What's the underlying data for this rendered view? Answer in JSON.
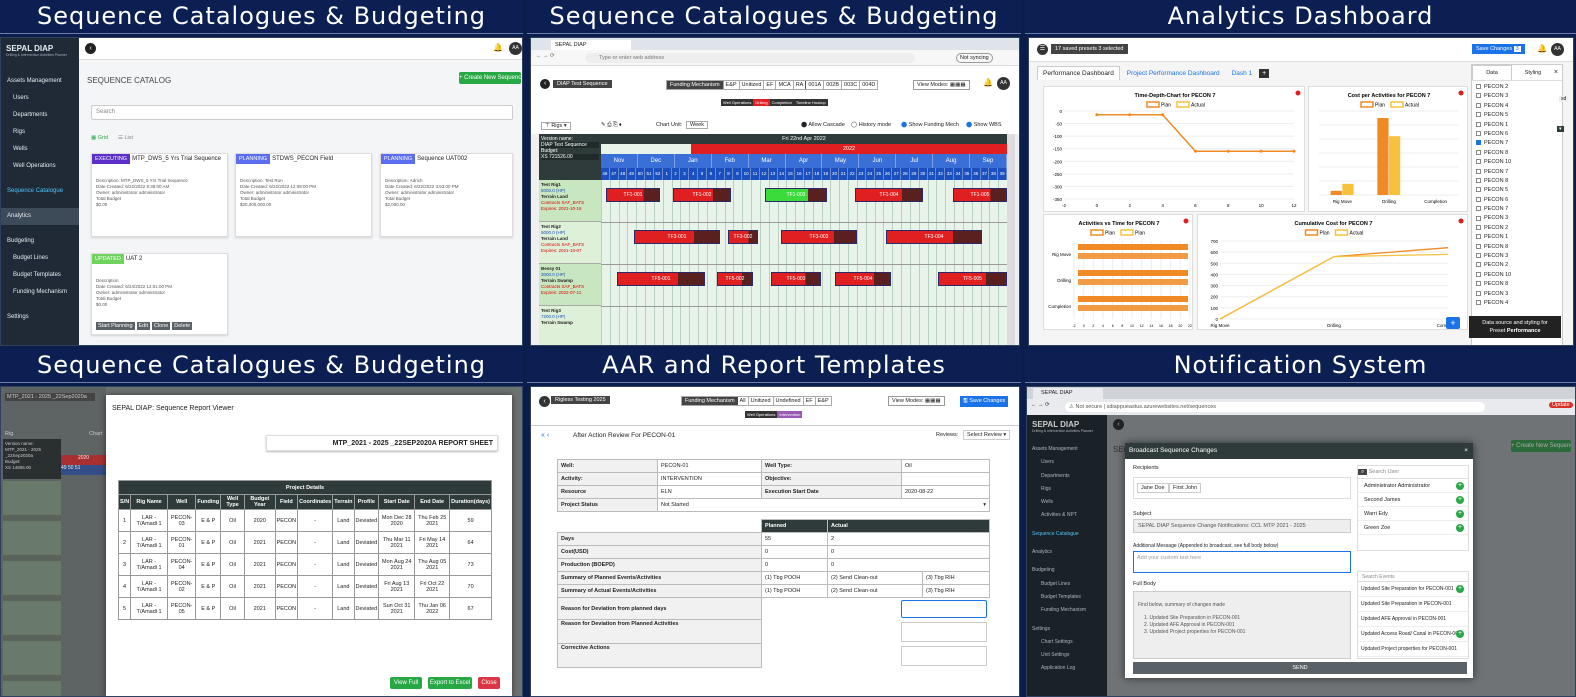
{
  "titles": [
    "Sequence Catalogues & Budgeting",
    "Sequence Catalogues & Budgeting",
    "Analytics Dashboard",
    "Sequence Catalogues & Budgeting",
    "AAR and Report Templates",
    "Notification System"
  ],
  "p1": {
    "brand": "SEPAL DIAP",
    "brand_sub": "Drilling & Intervention Activities Planner",
    "nav": [
      "Assets Management",
      "Users",
      "Departments",
      "Rigs",
      "Wells",
      "Well Operations",
      "Sequence Catalogue",
      "Analytics",
      "Budgeting",
      "Budget Lines",
      "Budget Templates",
      "Funding Mechanism",
      "Settings"
    ],
    "page_title": "SEQUENCE CATALOG",
    "create_btn": "+ Create New Sequence",
    "search_placeholder": "Search",
    "view_grid": "Grid",
    "view_list": "List",
    "avatar": "AA",
    "cards": [
      {
        "status": "EXECUTING",
        "title": "MTP_DWS_5 Yrs Trial Sequence",
        "color": "#5b2fc8",
        "lines": [
          "Description: MTP_DWS_5 Yrs Trial Sequence",
          "Date Created: 6/22/2022 8:38:00 AM",
          "Owner: administrator administrator",
          "Total Budget",
          "$0.00"
        ]
      },
      {
        "status": "PLANNING",
        "title": "STDWS_PECON Field",
        "color": "#5b6ef0",
        "lines": [
          "Description: Test Run",
          "Date Created: 6/22/2022 12:08:00 PM",
          "Owner: administrator administrator",
          "Total Budget",
          "$20,000,000.00"
        ]
      },
      {
        "status": "PLANNING",
        "title": "Sequence UAT002",
        "color": "#5b6ef0",
        "lines": [
          "Description: Adrich",
          "Date Created: 6/22/2022 3:53:00 PM",
          "Owner: administrator administrator",
          "Total Budget",
          "$2,000.00"
        ]
      },
      {
        "status": "UPDATED",
        "title": "UAT 2",
        "color": "#6fd35d",
        "lines": [
          "Description",
          "Date Created: 6/24/2022 12:01:00 PM",
          "Owner: administrator administrator",
          "Total Budget",
          "$0.00"
        ]
      }
    ],
    "card_actions": [
      "Start Planning",
      "Edit",
      "Clone",
      "Delete"
    ]
  },
  "p2": {
    "tab": "SEPAL DIAP",
    "address": "Type or enter web address",
    "sync": "Not syncing",
    "sequence": "DIAP Test Sequence",
    "funding_label": "Funding Mechanism",
    "funding": [
      "E&P",
      "Unitized",
      "EF",
      "MCA",
      "RA",
      "001A",
      "002B",
      "003C",
      "004D"
    ],
    "legend": [
      "Well Operations",
      "Drilling",
      "Completion",
      "Timeline Hookup"
    ],
    "view_modes": "View Modes:",
    "filter": "Rigs",
    "chart_unit_label": "Chart Unit:",
    "chart_unit": "Week",
    "toggles": [
      "Allow Cascade",
      "History mode",
      "Show Funding Mech",
      "Show WBS"
    ],
    "version_name": "Version name:",
    "version_val": "DIAP Test Sequence",
    "budget_label": "Budget:",
    "budget_val": "XS 721526.00",
    "date_header": "Fri 22nd Apr 2022",
    "year": "2022",
    "months": [
      "Nov",
      "Dec",
      "Jan",
      "Feb",
      "Mar",
      "Apr",
      "May",
      "Jun",
      "Jul",
      "Aug",
      "Sep"
    ],
    "weeks": [
      "46",
      "47",
      "48",
      "49",
      "50",
      "51",
      "52",
      "1",
      "2",
      "3",
      "4",
      "5",
      "6",
      "7",
      "8",
      "9",
      "10",
      "11",
      "12",
      "13",
      "14",
      "15",
      "16",
      "17",
      "18",
      "19",
      "20",
      "21",
      "22",
      "23",
      "24",
      "25",
      "26",
      "27",
      "28",
      "29",
      "30",
      "31",
      "32",
      "33",
      "34",
      "35",
      "36",
      "37",
      "38",
      "39"
    ],
    "rigs": [
      {
        "name": "Test Rig1",
        "line2": "5000.0 (HP)",
        "line3": "Terrain Land",
        "red1": "Contracts SAF_BATS",
        "red2": "Expires: 2021-10-16"
      },
      {
        "name": "Test Rig2",
        "line2": "5000.0 (HP)",
        "line3": "Terrain Land",
        "red1": "Contracts SAF_BATS",
        "red2": "Expires: 2021-10-07"
      },
      {
        "name": "Bessy 01",
        "line2": "3000.0 (HP)",
        "line3": "Terrain Swamp",
        "red1": "Contracts SAF_BATS",
        "red2": "Expires: 2022-07-11"
      },
      {
        "name": "Test Rig3",
        "line2": "7200.0 (HP)",
        "line3": "Terrain Swamp",
        "red1": "",
        "red2": ""
      }
    ],
    "bars": [
      "TF1-001",
      "TF1-002",
      "TF1-003",
      "TF1-004",
      "TF1-005",
      "TF3-001",
      "TF3-002",
      "TF3-003",
      "TF3-004",
      "TF5-001",
      "TF5-002",
      "TF5-003",
      "TF5-004",
      "TF5-005"
    ]
  },
  "p3": {
    "presets": "17 saved presets 3 selected",
    "save_btn": "Save Changes",
    "save_count": "3",
    "avatar": "AA",
    "tabs": [
      "Performance Dashboard",
      "Project Performance Dashboard",
      "Dash 1"
    ],
    "side_tabs": [
      "Data",
      "Styling"
    ],
    "list": [
      "PECON 2",
      "PECON 3",
      "PECON 4",
      "PECON 5",
      "PECON 1",
      "PECON 6",
      "PECON 7",
      "PECON 8",
      "PECON 10",
      "PECON 7",
      "PECON 8",
      "PECON 5",
      "PECON 6",
      "PECON 7",
      "PECON 3",
      "PECON 2",
      "PECON 1",
      "PECON 8",
      "PECON 3",
      "PECON 2",
      "PECON 10",
      "PECON 8",
      "PECON 3",
      "PECON 4"
    ],
    "checked_index": 6,
    "tooltip_line1": "Data source and styling for",
    "tooltip_line2": "Preset",
    "tooltip_bold": "Performance",
    "dropdown_frag": "sd",
    "legend_plan": "Plan",
    "legend_actual": "Actual",
    "colors": {
      "plan": "#f08a24",
      "actual": "#f6c23e",
      "primary": "#1a73e8",
      "red": "#e02020"
    }
  },
  "chart_data": [
    {
      "type": "line",
      "title": "Time-Depth-Chart for PECON 7",
      "legend": [
        "Plan",
        "Actual"
      ],
      "xlabel": "",
      "ylabel": "",
      "x": [
        0,
        2,
        4,
        6,
        8,
        10,
        12
      ],
      "series": [
        {
          "name": "Plan",
          "values": [
            -15,
            -15,
            -15,
            -160,
            -160,
            -160,
            -160
          ]
        }
      ],
      "yticks": [
        "0",
        "-50",
        "-100",
        "-150",
        "-200",
        "-250",
        "-300",
        "-350"
      ],
      "xticks": [
        "-2",
        "0",
        "2",
        "4",
        "6",
        "8",
        "10",
        "12"
      ],
      "ylim": [
        -350,
        0
      ]
    },
    {
      "type": "bar",
      "title": "Cost per Activities for PECON 7",
      "legend": [
        "Plan",
        "Actual"
      ],
      "categories": [
        "Rig Move",
        "Drilling",
        "Completion"
      ],
      "series": [
        {
          "name": "Plan",
          "values": [
            3,
            55,
            0
          ]
        },
        {
          "name": "Actual",
          "values": [
            8,
            42,
            0
          ]
        }
      ]
    },
    {
      "type": "bar",
      "title": "Activities vs Time for PECON 7",
      "legend": [
        "Plan",
        "Plan"
      ],
      "categories": [
        "Rig Move",
        "Drilling",
        "Completion"
      ],
      "orientation": "horizontal",
      "xticks": [
        "-2",
        "0",
        "2",
        "4",
        "6",
        "8",
        "10",
        "12",
        "14",
        "16",
        "18",
        "20",
        "22"
      ]
    },
    {
      "type": "line",
      "title": "Cumulative Cost for PECON 7",
      "legend": [
        "Plan",
        "Actual"
      ],
      "categories": [
        "Rig Move",
        "Drilling",
        "Completion"
      ],
      "series": [
        {
          "name": "Plan",
          "values": [
            0,
            560,
            640
          ]
        },
        {
          "name": "Actual",
          "values": [
            0,
            560,
            580
          ]
        }
      ],
      "yticks": [
        "700",
        "600",
        "500",
        "400",
        "300",
        "200",
        "100",
        "0"
      ],
      "ylim": [
        0,
        700
      ]
    }
  ],
  "p4": {
    "modal_title": "SEPAL DIAP: Sequence Report Viewer",
    "sheet_title": "MTP_2021 - 2025 _22SEP2020A REPORT SHEET",
    "table_title": "Project Details",
    "headers": [
      "S/N",
      "Rig Name",
      "Well",
      "Funding",
      "Well Type",
      "Budget Year",
      "Field",
      "Coordinates",
      "Terrain",
      "Profile",
      "Start Date",
      "End Date",
      "Duration(days)"
    ],
    "rows": [
      [
        "1",
        "LAR - T/Amadi 1",
        "PECON-03",
        "E & P",
        "Oil",
        "2020",
        "PECON",
        "-",
        "Land",
        "Deviated",
        "Mon Dec 28 2020",
        "Thu Feb 25 2021",
        "59"
      ],
      [
        "2",
        "LAR - T/Amadi 1",
        "PECON-01",
        "E & P",
        "Oil",
        "2021",
        "PECON",
        "-",
        "Land",
        "Deviated",
        "Thu Mar 11 2021",
        "Fri May 14 2021",
        "64"
      ],
      [
        "3",
        "LAR - T/Amadi 1",
        "PECON-04",
        "E & P",
        "Oil",
        "2021",
        "PECON",
        "-",
        "Land",
        "Deviated",
        "Mon Aug 24 2021",
        "Thu Aug 05 2021",
        "73"
      ],
      [
        "4",
        "LAR - T/Amadi 1",
        "PECON-02",
        "E & P",
        "Oil",
        "2021",
        "PECON",
        "-",
        "Land",
        "Deviated",
        "Fri Aug 13 2021",
        "Fri Oct 22 2021",
        "70"
      ],
      [
        "5",
        "LAR - T/Amadi 1",
        "PECON-05",
        "E & P",
        "Oil",
        "2021",
        "PECON",
        "-",
        "Land",
        "Deviated",
        "Sun Oct 31 2021",
        "Thu Jan 06 2022",
        "67"
      ]
    ],
    "btn_view": "View Full",
    "btn_export": "Export to Excel",
    "btn_close": "Close",
    "bg_seq": "MTP_2021 - 2025 _22Sep2020a",
    "bg_version": "Version name:",
    "bg_version_val": "MTP_2021 - 2025 _22Sep2020a",
    "bg_budget": "Budget:",
    "bg_budget_val": "XS 14866.00",
    "bg_year": "2020",
    "bg_weeks": [
      "49",
      "50",
      "51"
    ],
    "bg_filter": "Rig",
    "bg_chart": "Chart"
  },
  "p5": {
    "sequence": "Rigless Testing 2025",
    "funding_label": "Funding Mechanism",
    "funding": [
      "All",
      "Unitized",
      "Undefined",
      "EF",
      "E&P"
    ],
    "legend": [
      "Well Operations",
      "Intervention"
    ],
    "view_modes": "View Modes:",
    "save_btn": "Save Changes",
    "title": "After Action Review For PECON-01",
    "reviews_label": "Reviews:",
    "reviews_val": "Select Review",
    "info": [
      [
        "Well:",
        "PECON-01",
        "Well Type:",
        "Oil"
      ],
      [
        "Activity:",
        "INTERVENTION",
        "Objective:",
        ""
      ],
      [
        "Resource",
        "ELN",
        "Execution Start Date",
        "2020-08-22"
      ]
    ],
    "status_label": "Project Status",
    "status_val": "Not Started",
    "col_planned": "Planned",
    "col_actual": "Actual",
    "rows": [
      [
        "Days",
        "55",
        "2"
      ],
      [
        "Cost(USD)",
        "0",
        "0"
      ],
      [
        "Production (BOEPD)",
        "0",
        "0"
      ]
    ],
    "planned_events": [
      "(1) Tbg POOH",
      "(2) Send Clean-out",
      "(3) Tbg RIH"
    ],
    "actual_events": [
      "(1) Tbg POOH",
      "(2) Send Clean-out",
      "(3) Tbg RIH"
    ],
    "labels": [
      "Summary of Planned Events/Activities",
      "Summary of Actual Events/Activities",
      "Reason for Deviation from planned days",
      "Reason for Deviation from Planned Activities",
      "Corrective Actions"
    ]
  },
  "p6": {
    "tab": "SEPAL DIAP",
    "url_prefix": "Not secure",
    "url": "sdiappueastus.azurewebsites.net/sequences",
    "update": "Update",
    "brand": "SEPAL DIAP",
    "brand_sub": "Drilling & Intervention Activities Planner",
    "nav": [
      "Assets Management",
      "Users",
      "Departments",
      "Rigs",
      "Wells",
      "Activities & NPT",
      "Sequence Catalogue",
      "Analytics",
      "Budgeting",
      "Budget Lines",
      "Budget Templates",
      "Funding Mechanism",
      "Settings",
      "Chart Settings",
      "Unit Settings",
      "Application Log"
    ],
    "bg_title": "SEQ",
    "create_btn": "+ Create New Sequence",
    "modal_title": "Broadcast Sequence Changes",
    "recipients_label": "Recipients",
    "recipients": [
      "Jane Doe",
      "First John"
    ],
    "users_placeholder": "Search User",
    "users": [
      "Administrator Administrator",
      "Second James",
      "Warri Edy",
      "Green Zoe"
    ],
    "subject_label": "Subject",
    "subject_val": "SEPAL DIAP Sequence Change Notifications: CCL MTP 2021 - 2025",
    "message_label": "Additional Message (Appended to broadcast, see full body below)",
    "message_placeholder": "Add your custom text here",
    "body_label": "Full Body",
    "body_lines": [
      "Find below, summary of changes made",
      "1. Updated Site Preparation in PECON-001",
      "2. Updated AFE Approval in PECON-001",
      "3. Updated Project properties for PECON-001"
    ],
    "events_placeholder": "Search Events",
    "events": [
      "Updated Site Preparation for PECON-001",
      "Updated Site Preparation in PECON-001",
      "Updated AFE Approval in PECON-001",
      "Updated Access Road/ Canal in PECON-001",
      "Updated Project properties for PECON-001",
      "Updated Project properties for PECON-001"
    ],
    "send": "SEND"
  }
}
